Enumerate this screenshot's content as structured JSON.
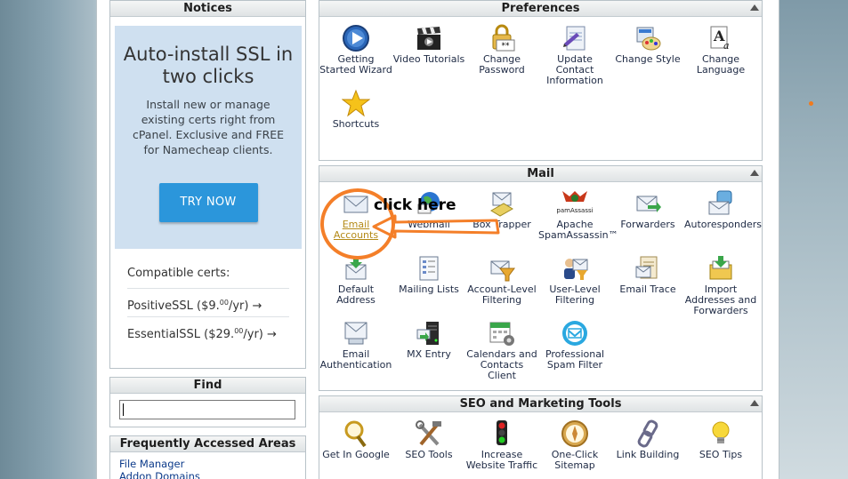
{
  "notices": {
    "title": "Notices",
    "promo_title": "Auto-install SSL in two clicks",
    "promo_desc": "Install new or manage existing certs right from cPanel. Exclusive and FREE for Namecheap clients.",
    "try_button": "TRY NOW",
    "compatible_label": "Compatible certs:",
    "cert1_name": "PositiveSSL ($9.",
    "cert1_cents": "00",
    "cert1_suffix": "/yr) →",
    "cert2_name": "EssentialSSL ($29.",
    "cert2_cents": "00",
    "cert2_suffix": "/yr) →"
  },
  "find": {
    "title": "Find",
    "value": ""
  },
  "frequent": {
    "title": "Frequently Accessed Areas",
    "links": [
      "File Manager",
      "Addon Domains"
    ]
  },
  "preferences": {
    "title": "Preferences",
    "items": [
      {
        "label": "Getting Started Wizard",
        "icon": "wizard-play-icon"
      },
      {
        "label": "Video Tutorials",
        "icon": "clapperboard-icon"
      },
      {
        "label": "Change Password",
        "icon": "lock-password-icon"
      },
      {
        "label": "Update Contact Information",
        "icon": "contact-document-icon"
      },
      {
        "label": "Change Style",
        "icon": "palette-style-icon"
      },
      {
        "label": "Change Language",
        "icon": "language-icon"
      },
      {
        "label": "Shortcuts",
        "icon": "star-icon"
      }
    ]
  },
  "mail": {
    "title": "Mail",
    "items": [
      {
        "label": "Email Accounts",
        "icon": "envelope-icon"
      },
      {
        "label": "Webmail",
        "icon": "globe-mail-icon"
      },
      {
        "label": "Box Trapper",
        "icon": "trap-icon"
      },
      {
        "label": "Apache SpamAssassin™",
        "icon": "spamassassin-icon"
      },
      {
        "label": "Forwarders",
        "icon": "forward-envelope-icon"
      },
      {
        "label": "Autoresponders",
        "icon": "autoresponder-icon"
      },
      {
        "label": "Default Address",
        "icon": "default-address-icon"
      },
      {
        "label": "Mailing Lists",
        "icon": "mailing-list-icon"
      },
      {
        "label": "Account-Level Filtering",
        "icon": "filter-icon"
      },
      {
        "label": "User-Level Filtering",
        "icon": "user-filter-icon"
      },
      {
        "label": "Email Trace",
        "icon": "email-trace-icon"
      },
      {
        "label": "Import Addresses and Forwarders",
        "icon": "import-icon"
      },
      {
        "label": "Email Authentication",
        "icon": "email-auth-icon"
      },
      {
        "label": "MX Entry",
        "icon": "server-icon"
      },
      {
        "label": "Calendars and Contacts Client",
        "icon": "calendar-icon"
      },
      {
        "label": "Professional Spam Filter",
        "icon": "spam-filter-icon"
      }
    ]
  },
  "seo": {
    "title": "SEO and Marketing Tools",
    "items": [
      {
        "label": "Get In Google",
        "icon": "magnifier-icon"
      },
      {
        "label": "SEO Tools",
        "icon": "tools-icon"
      },
      {
        "label": "Increase Website Traffic",
        "icon": "traffic-light-icon"
      },
      {
        "label": "One-Click Sitemap",
        "icon": "compass-icon"
      },
      {
        "label": "Link Building",
        "icon": "chain-link-icon"
      },
      {
        "label": "SEO Tips",
        "icon": "lightbulb-icon"
      }
    ]
  },
  "annotation": {
    "text": "click here",
    "color": "#f47f29"
  },
  "colors": {
    "accent": "#2b96db",
    "promo_bg": "#cfe0f0",
    "link": "#b48a18"
  }
}
